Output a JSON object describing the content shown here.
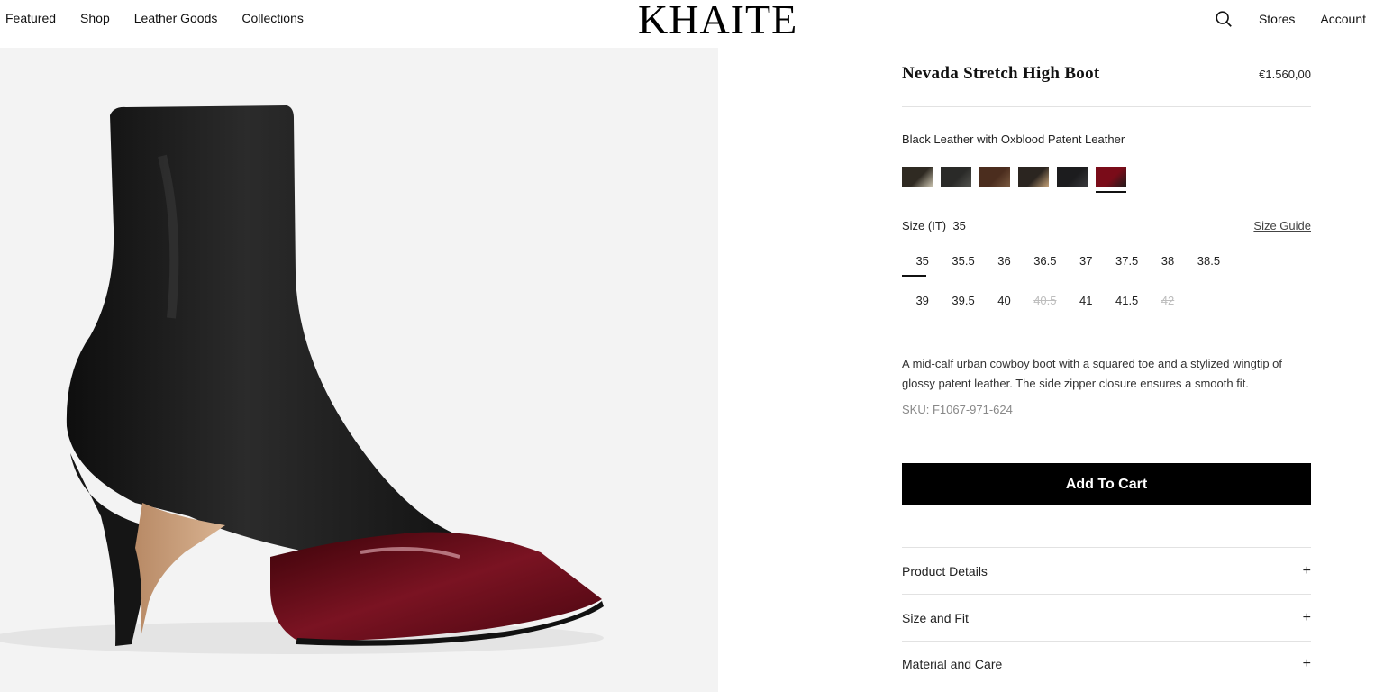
{
  "header": {
    "nav_left": [
      "Featured",
      "Shop",
      "Leather Goods",
      "Collections"
    ],
    "logo": "KHAITE",
    "nav_right": {
      "stores": "Stores",
      "account": "Account"
    },
    "icons": {
      "search": "search-icon"
    }
  },
  "product": {
    "title": "Nevada Stretch High Boot",
    "price": "€1.560,00",
    "color_name": "Black Leather with Oxblood Patent Leather",
    "swatches": [
      {
        "color": "#2f2a22",
        "accent": "#cfc8b4",
        "selected": false
      },
      {
        "color": "#2a2a28",
        "accent": "#555550",
        "selected": false
      },
      {
        "color": "#4b2d1e",
        "accent": "#7a5a40",
        "selected": false
      },
      {
        "color": "#2b2520",
        "accent": "#c9a57a",
        "selected": false
      },
      {
        "color": "#1c1c1e",
        "accent": "#3a3a3e",
        "selected": false
      },
      {
        "color": "#7a0c19",
        "accent": "#1b1b1b",
        "selected": true
      }
    ],
    "size_label": "Size (IT)",
    "selected_size": "35",
    "size_guide": "Size Guide",
    "sizes": [
      {
        "label": "35",
        "available": true,
        "selected": true
      },
      {
        "label": "35.5",
        "available": true,
        "selected": false
      },
      {
        "label": "36",
        "available": true,
        "selected": false
      },
      {
        "label": "36.5",
        "available": true,
        "selected": false
      },
      {
        "label": "37",
        "available": true,
        "selected": false
      },
      {
        "label": "37.5",
        "available": true,
        "selected": false
      },
      {
        "label": "38",
        "available": true,
        "selected": false
      },
      {
        "label": "38.5",
        "available": true,
        "selected": false
      },
      {
        "label": "39",
        "available": true,
        "selected": false
      },
      {
        "label": "39.5",
        "available": true,
        "selected": false
      },
      {
        "label": "40",
        "available": true,
        "selected": false
      },
      {
        "label": "40.5",
        "available": false,
        "selected": false
      },
      {
        "label": "41",
        "available": true,
        "selected": false
      },
      {
        "label": "41.5",
        "available": true,
        "selected": false
      },
      {
        "label": "42",
        "available": false,
        "selected": false
      }
    ],
    "description": "A mid-calf urban cowboy boot with a squared toe and a stylized wingtip of glossy patent leather. The side zipper closure ensures a smooth fit.",
    "sku": "SKU: F1067-971-624",
    "add_to_cart": "Add To Cart",
    "accordions": [
      "Product Details",
      "Size and Fit",
      "Material and Care"
    ],
    "accordion_icon": "plus-icon"
  },
  "colors": {
    "image_bg": "#f3f3f3",
    "button_bg": "#000000",
    "leather": "#1a1a1a",
    "patent": "#6e0d1a"
  }
}
